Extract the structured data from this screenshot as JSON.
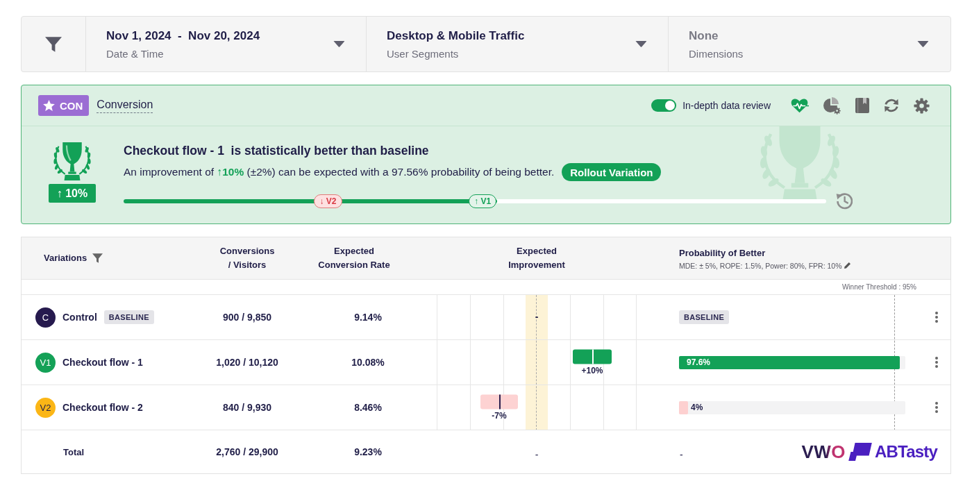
{
  "filters": [
    {
      "value": "Nov 1, 2024  -  Nov 20, 2024",
      "label": "Date & Time"
    },
    {
      "value": "Desktop & Mobile Traffic",
      "label": "User Segments"
    },
    {
      "placeholder": "None",
      "label": "Dimensions"
    }
  ],
  "metric": {
    "badge": "CON",
    "name": "Conversion",
    "toggle": {
      "label": "In-depth data review",
      "on": true
    }
  },
  "result": {
    "badge": "↑ 10%",
    "title": "Checkout flow - 1  is statistically better than baseline",
    "description": "An improvement of **↑10%** (±2%) can be expected with a 97.56% probability of being better.",
    "button": "Rollout Variation",
    "slider": {
      "level": 0.532,
      "markers": [
        {
          "kind": "negative",
          "label": "↓ V2",
          "level": 0.291
        },
        {
          "kind": "positive",
          "label": "↑ V1",
          "level": 0.511
        }
      ]
    }
  },
  "table": {
    "columns": [
      "Variations",
      "Conversions / Visitors",
      "Expected Conversion Rate",
      "Expected Improvement",
      "Probability of Better"
    ],
    "probability_note": "MDE: ± 5%, ROPE: 1.5%, Power: 80%, FPR: 10%",
    "threshold": {
      "label": "Winner Threshold : 95%",
      "level": 0.95
    },
    "rows": [
      {
        "avatar": "C",
        "color": "#261a4e",
        "name": "Control",
        "tag": "BASELINE",
        "conversions": "900 / 9,850",
        "rate": "9.14%",
        "improvement": {
          "kind": "none",
          "label": "-"
        },
        "probability": {
          "kind": "baseline",
          "label": "BASELINE"
        }
      },
      {
        "avatar": "V1",
        "color": "#14a157",
        "name": "Checkout flow - 1",
        "conversions": "1,020 / 10,120",
        "rate": "10.08%",
        "improvement": {
          "kind": "positive",
          "label": "+10%"
        },
        "probability": {
          "kind": "positive",
          "level": 0.976,
          "label": "97.6%"
        }
      },
      {
        "avatar": "V2",
        "color": "#fbb616",
        "name": "Checkout flow - 2",
        "conversions": "840 / 9,930",
        "rate": "8.46%",
        "improvement": {
          "kind": "negative",
          "label": "-7%"
        },
        "probability": {
          "kind": "negative",
          "level": 0.04,
          "label": "4%"
        }
      }
    ],
    "total": {
      "label": "Total",
      "conversions": "2,760 / 29,900",
      "rate": "9.23%",
      "improvement": "-",
      "probability": "-"
    },
    "logos": [
      "VWO",
      "ABTasty"
    ]
  }
}
